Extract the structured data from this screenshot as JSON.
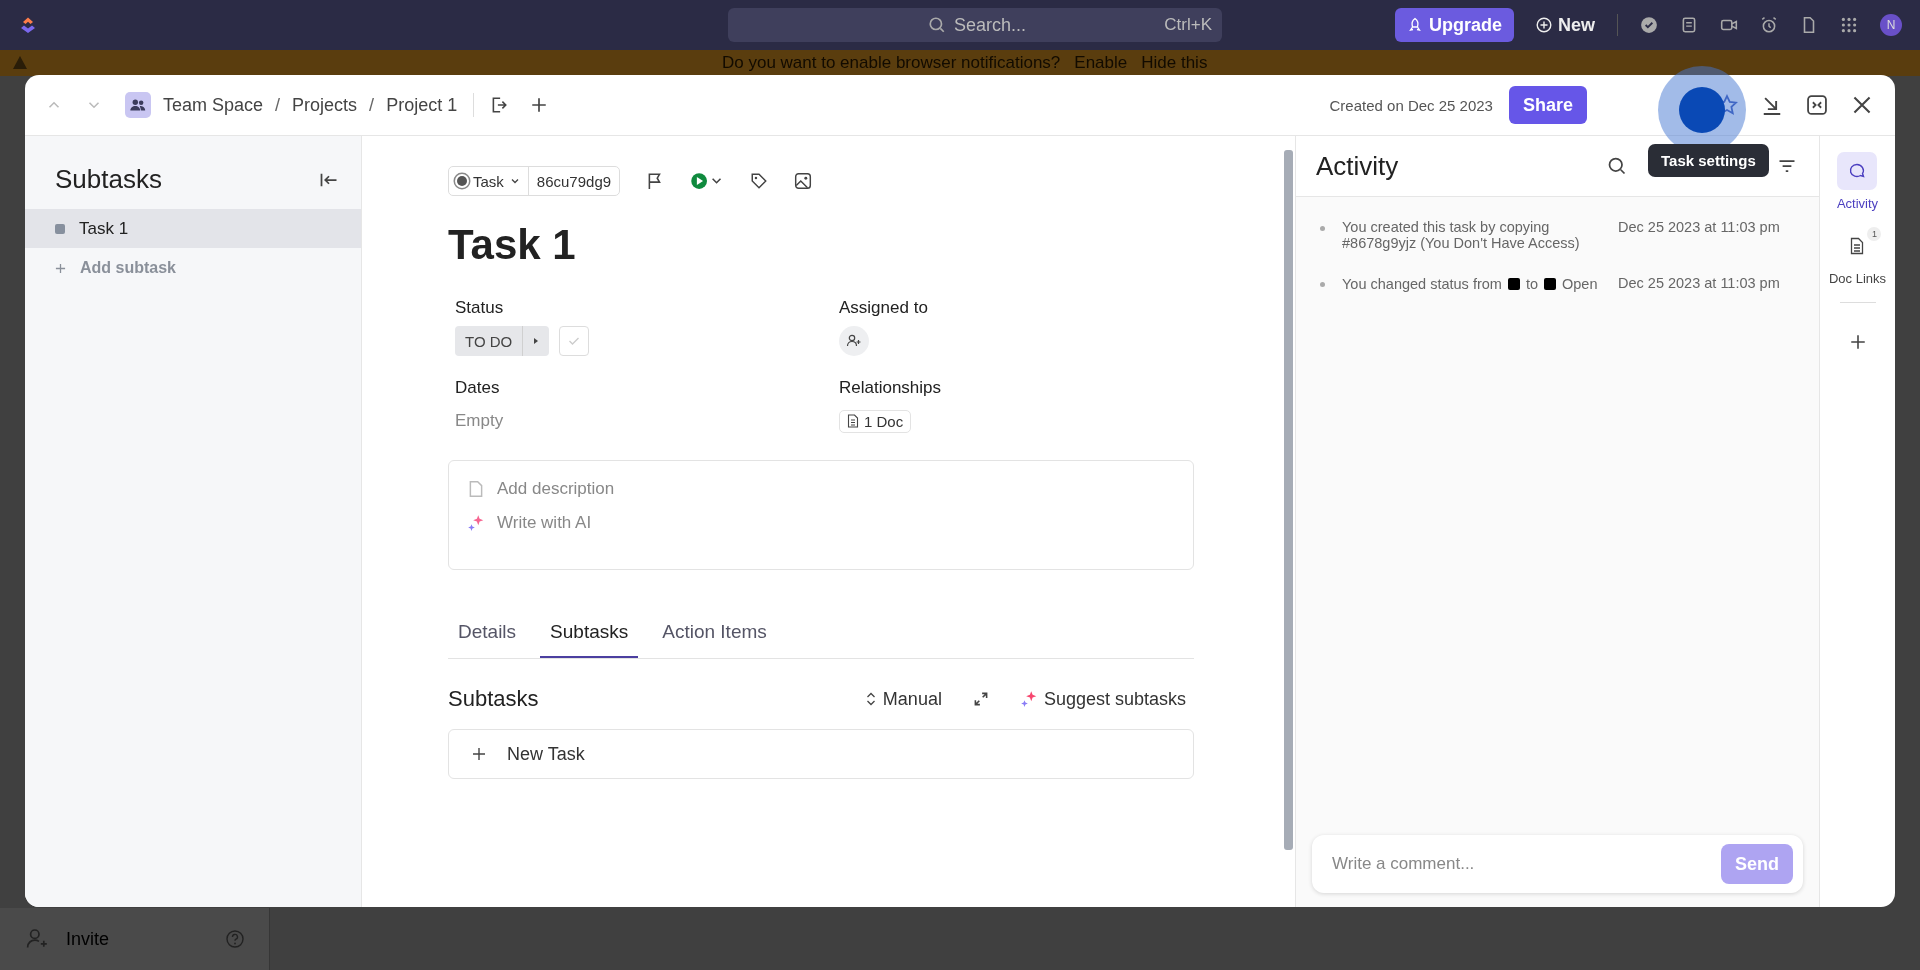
{
  "top_bar": {
    "search_placeholder": "Search...",
    "shortcut": "Ctrl+K",
    "upgrade": "Upgrade",
    "new": "New",
    "avatar_initial": "N"
  },
  "banner": {
    "text": "Do you want to enable browser notifications?",
    "actions": [
      "Enable",
      "Hide this"
    ]
  },
  "background": {
    "invite": "Invite"
  },
  "modal": {
    "breadcrumb": [
      "Team Space",
      "Projects",
      "Project 1"
    ],
    "breadcrumb_separator": "/",
    "created": "Created on Dec 25 2023",
    "share": "Share",
    "tooltip": "Task settings"
  },
  "subtasks_panel": {
    "title": "Subtasks",
    "items": [
      {
        "label": "Task 1",
        "selected": true
      }
    ],
    "add": "Add subtask"
  },
  "task": {
    "type": "Task",
    "id": "86cu79dg9",
    "title": "Task 1",
    "fields": [
      {
        "label": "Status",
        "kind": "status",
        "value": "TO DO",
        "complete": false
      },
      {
        "label": "Assigned to",
        "kind": "assignee"
      },
      {
        "label": "Dates",
        "kind": "text",
        "value": "Empty"
      },
      {
        "label": "Relationships",
        "kind": "doc",
        "value": "1 Doc"
      }
    ],
    "description_placeholder": "Add description",
    "ai": "Write with AI",
    "tabs": [
      {
        "label": "Details",
        "selected": false
      },
      {
        "label": "Subtasks",
        "selected": true
      },
      {
        "label": "Action Items",
        "selected": false
      }
    ],
    "subtasks": {
      "title": "Subtasks",
      "sort": "Manual",
      "suggest": "Suggest subtasks",
      "new_task": "New Task"
    }
  },
  "activity": {
    "title": "Activity",
    "entries": [
      {
        "parts": [
          {
            "kind": "text",
            "text": "You  created this task by copying #8678g9yjz (You Don't Have Access)"
          }
        ],
        "time": "Dec 25 2023 at 11:03 pm"
      },
      {
        "parts": [
          {
            "kind": "text",
            "text": "You  changed status from"
          },
          {
            "kind": "swatch",
            "color": "#000000"
          },
          {
            "kind": "text",
            "text": "to"
          },
          {
            "kind": "swatch",
            "color": "#000000"
          },
          {
            "kind": "text",
            "text": "Open"
          }
        ],
        "time": "Dec 25 2023 at 11:03 pm"
      }
    ],
    "comment_placeholder": "Write a comment...",
    "send": "Send",
    "send_disabled": true
  },
  "rail": [
    {
      "label": "Activity",
      "kind": "comments",
      "selected": true
    },
    {
      "label": "Doc Links",
      "kind": "doc",
      "selected": false,
      "badge": "1"
    }
  ]
}
